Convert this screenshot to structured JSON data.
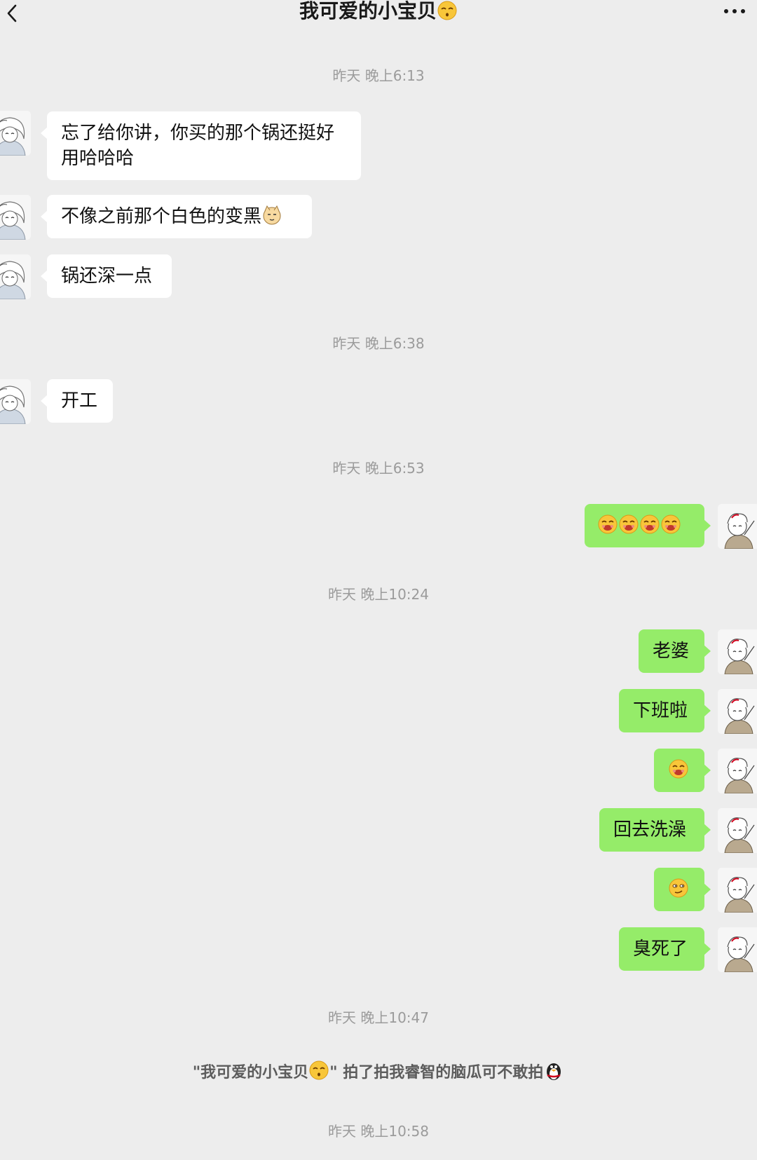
{
  "header": {
    "title": "我可爱的小宝贝",
    "title_emoji": "kissing-face-icon",
    "back_icon": "chevron-left-icon",
    "more_icon": "more-dots-icon"
  },
  "messages": {
    "t1": "昨天 晚上6:13",
    "m1": "忘了给你讲，你买的那个锅还挺好用哈哈哈",
    "m2": "不像之前那个白色的变黑",
    "m3": "锅还深一点",
    "t2": "昨天 晚上6:38",
    "m4": "开工",
    "t3": "昨天 晚上6:53",
    "m5_emoji": "giggle-face-icon",
    "t4": "昨天 晚上10:24",
    "m6": "老婆",
    "m7": "下班啦",
    "m8_emoji": "giggle-face-icon",
    "m9": "回去洗澡",
    "m10_emoji": "smirk-face-icon",
    "m11": "臭死了",
    "t5": "昨天 晚上10:47",
    "pat_prefix": "\"我可爱的小宝贝",
    "pat_suffix": "\" 拍了拍我睿智的脑瓜可不敢拍",
    "t6": "昨天 晚上10:58"
  },
  "colors": {
    "background": "#ededed",
    "incoming_bubble": "#ffffff",
    "outgoing_bubble": "#95ec69",
    "timestamp": "#9b9b9b"
  }
}
